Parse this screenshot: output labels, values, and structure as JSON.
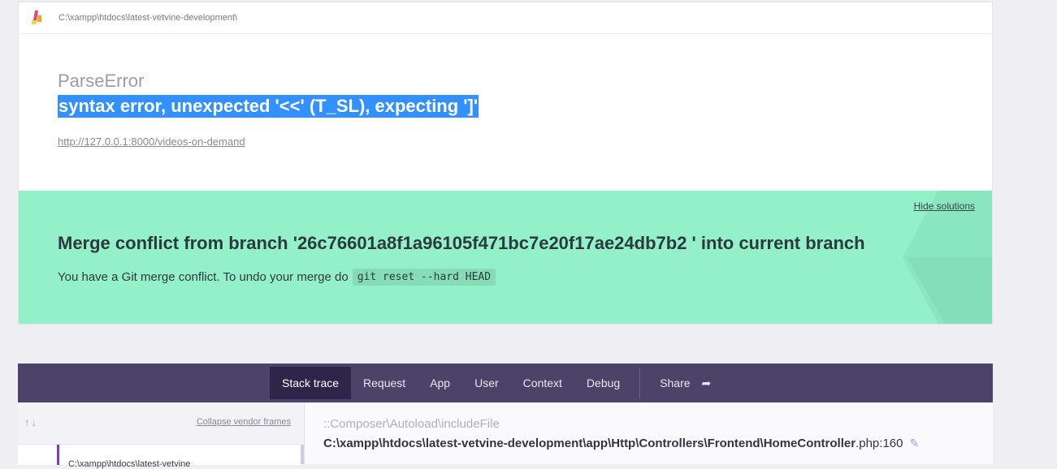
{
  "header": {
    "path": "C:\\xampp\\htdocs\\latest-vetvine-development\\"
  },
  "error": {
    "type": "ParseError",
    "message": "syntax error, unexpected '<<' (T_SL), expecting ']'",
    "url": "http://127.0.0.1:8000/videos-on-demand"
  },
  "solution": {
    "hide_label": "Hide solutions",
    "title": "Merge conflict from branch '26c76601a8f1a96105f471bc7e20f17ae24db7b2 ' into current branch",
    "description": "You have a Git merge conflict. To undo your merge do",
    "command": "git reset --hard HEAD",
    "colors": {
      "background": "#94f0c9"
    }
  },
  "tabs": {
    "items": [
      "Stack trace",
      "Request",
      "App",
      "User",
      "Context",
      "Debug"
    ],
    "share_label": "Share",
    "active": "Stack trace",
    "colors": {
      "bar": "#4c4468",
      "active": "#2d2648"
    }
  },
  "stack": {
    "collapse_label": "Collapse vendor frames",
    "frame_text": "C:\\xampp\\htdocs\\latest-vetvine",
    "namespace": "::Composer\\Autoload\\includeFile",
    "file_path": "C:\\xampp\\htdocs\\latest-vetvine-development\\app\\Http\\Controllers\\Frontend\\HomeController",
    "file_suffix": ".php:160"
  }
}
